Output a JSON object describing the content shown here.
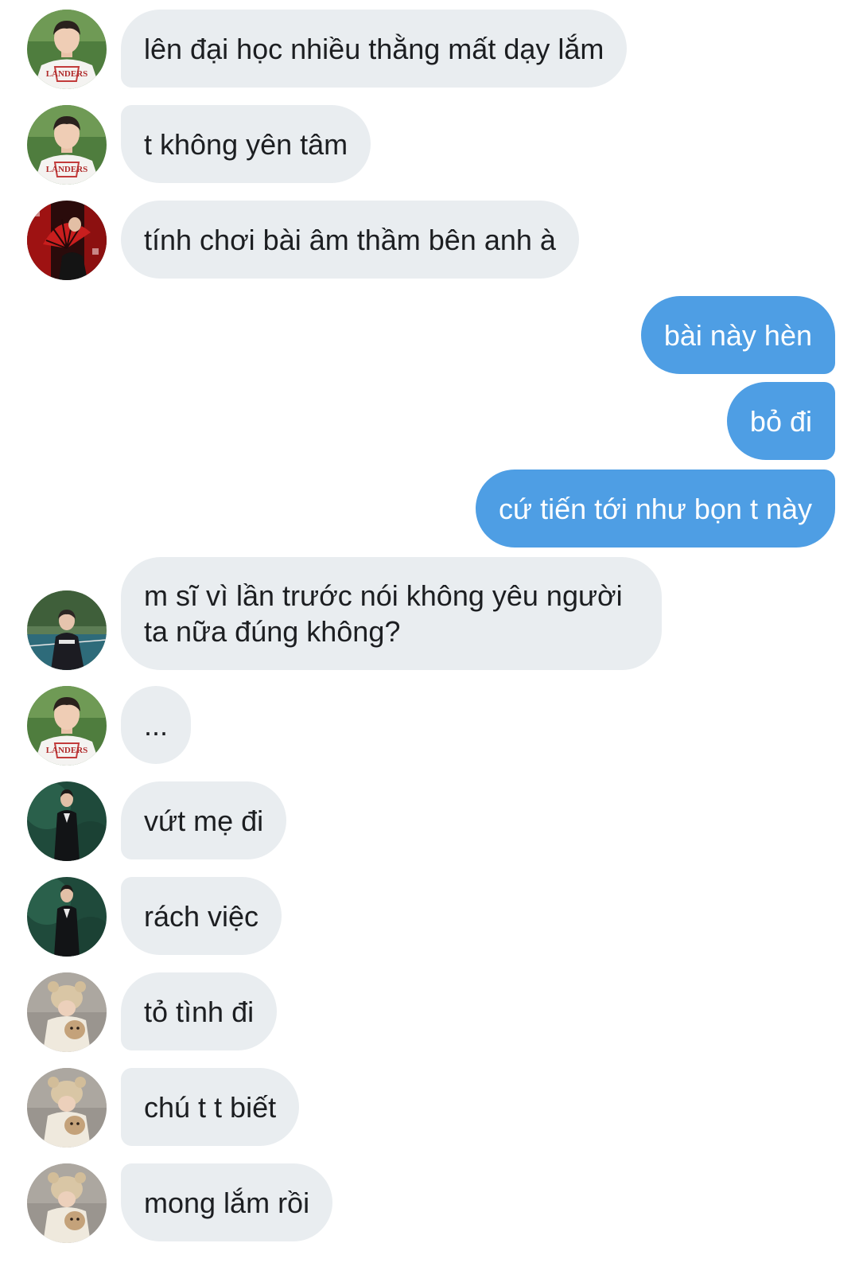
{
  "conversation": {
    "messages": [
      {
        "text": "lên đại học nhiều thằng mất dạy lắm",
        "avatar": "baseball-jersey-avatar"
      },
      {
        "text": "t không yên tâm",
        "avatar": "baseball-jersey-avatar"
      },
      {
        "text": "tính chơi bài âm thầm bên anh à",
        "avatar": "red-fan-avatar"
      },
      {
        "text": "bài này hèn"
      },
      {
        "text": "bỏ đi"
      },
      {
        "text": "cứ tiến tới như bọn t này"
      },
      {
        "text": "m sĩ vì lần trước nói không yêu người ta nữa đúng không?",
        "avatar": "court-portrait-avatar"
      },
      {
        "text": "...",
        "avatar": "baseball-jersey-avatar"
      },
      {
        "text": "vứt mẹ đi",
        "avatar": "suit-portrait-avatar"
      },
      {
        "text": "rách việc",
        "avatar": "suit-portrait-avatar"
      },
      {
        "text": "tỏ tình đi",
        "avatar": "bear-hat-avatar"
      },
      {
        "text": "chú t t biết",
        "avatar": "bear-hat-avatar"
      },
      {
        "text": "mong lắm rồi",
        "avatar": "bear-hat-avatar"
      }
    ]
  },
  "colors": {
    "background": "#ffffff",
    "incoming_bubble": "#e9edf0",
    "outgoing_bubble": "#4e9ee4",
    "incoming_text": "#1c1e21",
    "outgoing_text": "#ffffff"
  }
}
